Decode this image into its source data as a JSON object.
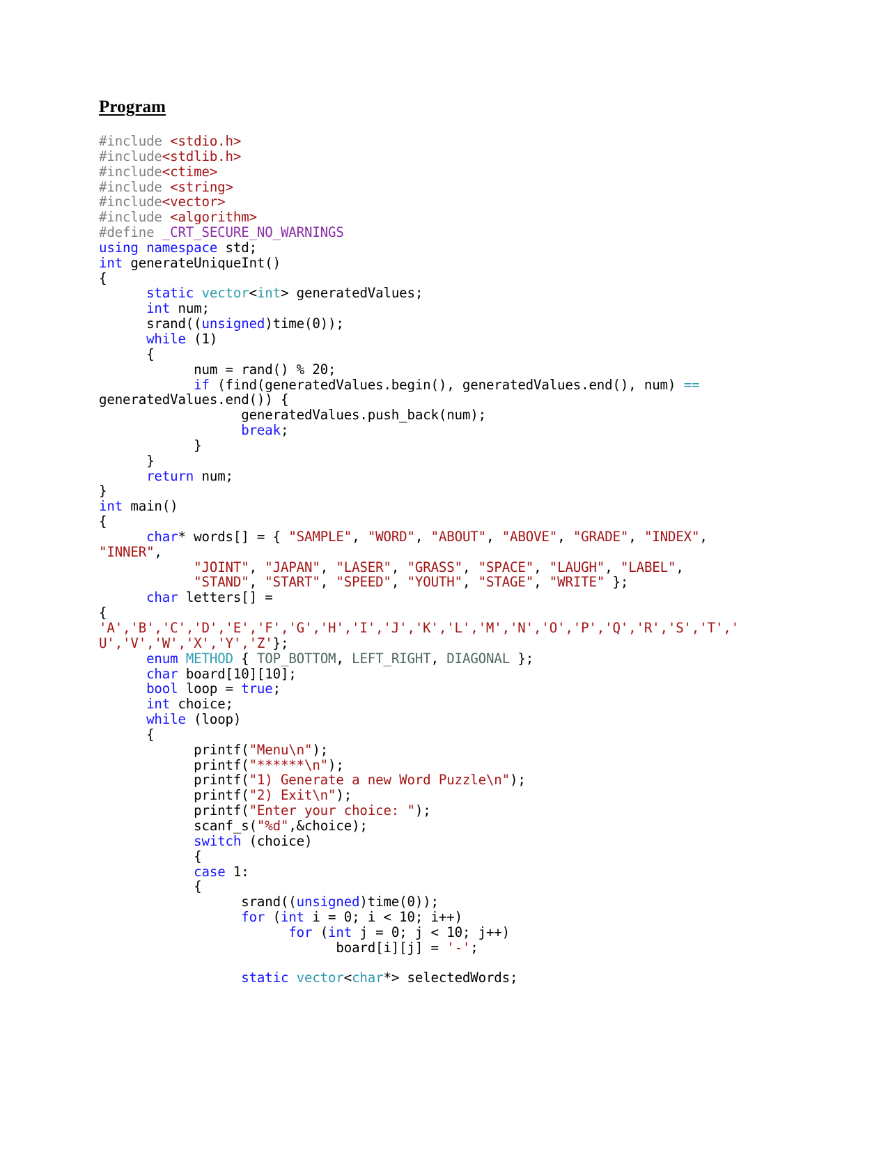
{
  "document": {
    "heading": "Program",
    "language": "cpp"
  },
  "code": {
    "lines": [
      [
        {
          "t": "#include ",
          "c": "pre"
        },
        {
          "t": "<stdio.h>",
          "c": "hdr"
        }
      ],
      [
        {
          "t": "#include",
          "c": "pre"
        },
        {
          "t": "<stdlib.h>",
          "c": "hdr"
        }
      ],
      [
        {
          "t": "#include",
          "c": "pre"
        },
        {
          "t": "<ctime>",
          "c": "hdr"
        }
      ],
      [
        {
          "t": "#include ",
          "c": "pre"
        },
        {
          "t": "<string>",
          "c": "hdr"
        }
      ],
      [
        {
          "t": "#include",
          "c": "pre"
        },
        {
          "t": "<vector>",
          "c": "hdr"
        }
      ],
      [
        {
          "t": "#include ",
          "c": "pre"
        },
        {
          "t": "<algorithm>",
          "c": "hdr"
        }
      ],
      [
        {
          "t": "#define ",
          "c": "pre"
        },
        {
          "t": "_CRT_SECURE_NO_WARNINGS",
          "c": "macro"
        }
      ],
      [
        {
          "t": "using namespace ",
          "c": "kw"
        },
        {
          "t": "std;",
          "c": "plain"
        }
      ],
      [
        {
          "t": "int",
          "c": "kw"
        },
        {
          "t": " generateUniqueInt()",
          "c": "plain"
        }
      ],
      [
        {
          "t": "{",
          "c": "plain"
        }
      ],
      [
        {
          "t": "      ",
          "c": "plain"
        },
        {
          "t": "static ",
          "c": "kw"
        },
        {
          "t": "vector",
          "c": "type"
        },
        {
          "t": "<",
          "c": "plain"
        },
        {
          "t": "int",
          "c": "type"
        },
        {
          "t": "> generatedValues;",
          "c": "plain"
        }
      ],
      [
        {
          "t": "      ",
          "c": "plain"
        },
        {
          "t": "int",
          "c": "kw"
        },
        {
          "t": " num;",
          "c": "plain"
        }
      ],
      [
        {
          "t": "      srand((",
          "c": "plain"
        },
        {
          "t": "unsigned",
          "c": "kw"
        },
        {
          "t": ")time(0));",
          "c": "plain"
        }
      ],
      [
        {
          "t": "      ",
          "c": "plain"
        },
        {
          "t": "while",
          "c": "kw"
        },
        {
          "t": " (1)",
          "c": "plain"
        }
      ],
      [
        {
          "t": "      {",
          "c": "plain"
        }
      ],
      [
        {
          "t": "            num = rand() % 20;",
          "c": "plain"
        }
      ],
      [
        {
          "t": "            ",
          "c": "plain"
        },
        {
          "t": "if",
          "c": "kw"
        },
        {
          "t": " (find(generatedValues.begin(), generatedValues.end(), num) ",
          "c": "plain"
        },
        {
          "t": "==",
          "c": "op"
        },
        {
          "t": "\ngeneratedValues.end()) {",
          "c": "plain"
        }
      ],
      [
        {
          "t": "                  generatedValues.push_back(num);",
          "c": "plain"
        }
      ],
      [
        {
          "t": "                  ",
          "c": "plain"
        },
        {
          "t": "break",
          "c": "kw"
        },
        {
          "t": ";",
          "c": "plain"
        }
      ],
      [
        {
          "t": "            }",
          "c": "plain"
        }
      ],
      [
        {
          "t": "      }",
          "c": "plain"
        }
      ],
      [
        {
          "t": "      ",
          "c": "plain"
        },
        {
          "t": "return",
          "c": "kw"
        },
        {
          "t": " num;",
          "c": "plain"
        }
      ],
      [
        {
          "t": "}",
          "c": "plain"
        }
      ],
      [
        {
          "t": "int",
          "c": "kw"
        },
        {
          "t": " main()",
          "c": "plain"
        }
      ],
      [
        {
          "t": "{",
          "c": "plain"
        }
      ],
      [
        {
          "t": "      ",
          "c": "plain"
        },
        {
          "t": "char",
          "c": "kw"
        },
        {
          "t": "* words[] = { ",
          "c": "plain"
        },
        {
          "t": "\"SAMPLE\"",
          "c": "str"
        },
        {
          "t": ", ",
          "c": "plain"
        },
        {
          "t": "\"WORD\"",
          "c": "str"
        },
        {
          "t": ", ",
          "c": "plain"
        },
        {
          "t": "\"ABOUT\"",
          "c": "str"
        },
        {
          "t": ", ",
          "c": "plain"
        },
        {
          "t": "\"ABOVE\"",
          "c": "str"
        },
        {
          "t": ", ",
          "c": "plain"
        },
        {
          "t": "\"GRADE\"",
          "c": "str"
        },
        {
          "t": ", ",
          "c": "plain"
        },
        {
          "t": "\"INDEX\"",
          "c": "str"
        },
        {
          "t": ",\n",
          "c": "plain"
        },
        {
          "t": "\"INNER\"",
          "c": "str"
        },
        {
          "t": ",",
          "c": "plain"
        }
      ],
      [
        {
          "t": "            ",
          "c": "plain"
        },
        {
          "t": "\"JOINT\"",
          "c": "str"
        },
        {
          "t": ", ",
          "c": "plain"
        },
        {
          "t": "\"JAPAN\"",
          "c": "str"
        },
        {
          "t": ", ",
          "c": "plain"
        },
        {
          "t": "\"LASER\"",
          "c": "str"
        },
        {
          "t": ", ",
          "c": "plain"
        },
        {
          "t": "\"GRASS\"",
          "c": "str"
        },
        {
          "t": ", ",
          "c": "plain"
        },
        {
          "t": "\"SPACE\"",
          "c": "str"
        },
        {
          "t": ", ",
          "c": "plain"
        },
        {
          "t": "\"LAUGH\"",
          "c": "str"
        },
        {
          "t": ", ",
          "c": "plain"
        },
        {
          "t": "\"LABEL\"",
          "c": "str"
        },
        {
          "t": ",",
          "c": "plain"
        }
      ],
      [
        {
          "t": "            ",
          "c": "plain"
        },
        {
          "t": "\"STAND\"",
          "c": "str"
        },
        {
          "t": ", ",
          "c": "plain"
        },
        {
          "t": "\"START\"",
          "c": "str"
        },
        {
          "t": ", ",
          "c": "plain"
        },
        {
          "t": "\"SPEED\"",
          "c": "str"
        },
        {
          "t": ", ",
          "c": "plain"
        },
        {
          "t": "\"YOUTH\"",
          "c": "str"
        },
        {
          "t": ", ",
          "c": "plain"
        },
        {
          "t": "\"STAGE\"",
          "c": "str"
        },
        {
          "t": ", ",
          "c": "plain"
        },
        {
          "t": "\"WRITE\"",
          "c": "str"
        },
        {
          "t": " };",
          "c": "plain"
        }
      ],
      [
        {
          "t": "      ",
          "c": "plain"
        },
        {
          "t": "char",
          "c": "kw"
        },
        {
          "t": " letters[] =",
          "c": "plain"
        }
      ],
      [
        {
          "t": "{",
          "c": "plain"
        }
      ],
      [
        {
          "t": "'A','B','C','D','E','F','G','H','I','J','K','L','M','N','O','P','Q','R','S','T','\nU','V','W','X','Y','Z'",
          "c": "str"
        },
        {
          "t": "};",
          "c": "plain"
        }
      ],
      [
        {
          "t": "      ",
          "c": "plain"
        },
        {
          "t": "enum ",
          "c": "kw"
        },
        {
          "t": "METHOD",
          "c": "type"
        },
        {
          "t": " { ",
          "c": "plain"
        },
        {
          "t": "TOP_BOTTOM",
          "c": "enum"
        },
        {
          "t": ", ",
          "c": "plain"
        },
        {
          "t": "LEFT_RIGHT",
          "c": "enum"
        },
        {
          "t": ", ",
          "c": "plain"
        },
        {
          "t": "DIAGONAL",
          "c": "enum"
        },
        {
          "t": " };",
          "c": "plain"
        }
      ],
      [
        {
          "t": "      ",
          "c": "plain"
        },
        {
          "t": "char",
          "c": "kw"
        },
        {
          "t": " board[10][10];",
          "c": "plain"
        }
      ],
      [
        {
          "t": "      ",
          "c": "plain"
        },
        {
          "t": "bool",
          "c": "kw"
        },
        {
          "t": " loop = ",
          "c": "plain"
        },
        {
          "t": "true",
          "c": "kw"
        },
        {
          "t": ";",
          "c": "plain"
        }
      ],
      [
        {
          "t": "      ",
          "c": "plain"
        },
        {
          "t": "int",
          "c": "kw"
        },
        {
          "t": " choice;",
          "c": "plain"
        }
      ],
      [
        {
          "t": "      ",
          "c": "plain"
        },
        {
          "t": "while",
          "c": "kw"
        },
        {
          "t": " (loop)",
          "c": "plain"
        }
      ],
      [
        {
          "t": "      {",
          "c": "plain"
        }
      ],
      [
        {
          "t": "            printf(",
          "c": "plain"
        },
        {
          "t": "\"Menu\\n\"",
          "c": "str"
        },
        {
          "t": ");",
          "c": "plain"
        }
      ],
      [
        {
          "t": "            printf(",
          "c": "plain"
        },
        {
          "t": "\"******\\n\"",
          "c": "str"
        },
        {
          "t": ");",
          "c": "plain"
        }
      ],
      [
        {
          "t": "            printf(",
          "c": "plain"
        },
        {
          "t": "\"1) Generate a new Word Puzzle\\n\"",
          "c": "str"
        },
        {
          "t": ");",
          "c": "plain"
        }
      ],
      [
        {
          "t": "            printf(",
          "c": "plain"
        },
        {
          "t": "\"2) Exit\\n\"",
          "c": "str"
        },
        {
          "t": ");",
          "c": "plain"
        }
      ],
      [
        {
          "t": "            printf(",
          "c": "plain"
        },
        {
          "t": "\"Enter your choice: \"",
          "c": "str"
        },
        {
          "t": ");",
          "c": "plain"
        }
      ],
      [
        {
          "t": "            scanf_s(",
          "c": "plain"
        },
        {
          "t": "\"%d\"",
          "c": "str"
        },
        {
          "t": ",&choice);",
          "c": "plain"
        }
      ],
      [
        {
          "t": "            ",
          "c": "plain"
        },
        {
          "t": "switch",
          "c": "kw"
        },
        {
          "t": " (choice)",
          "c": "plain"
        }
      ],
      [
        {
          "t": "            {",
          "c": "plain"
        }
      ],
      [
        {
          "t": "            ",
          "c": "plain"
        },
        {
          "t": "case",
          "c": "kw"
        },
        {
          "t": " 1:",
          "c": "plain"
        }
      ],
      [
        {
          "t": "            {",
          "c": "plain"
        }
      ],
      [
        {
          "t": "                  srand((",
          "c": "plain"
        },
        {
          "t": "unsigned",
          "c": "kw"
        },
        {
          "t": ")time(0));",
          "c": "plain"
        }
      ],
      [
        {
          "t": "                  ",
          "c": "plain"
        },
        {
          "t": "for",
          "c": "kw"
        },
        {
          "t": " (",
          "c": "plain"
        },
        {
          "t": "int",
          "c": "kw"
        },
        {
          "t": " i = 0; i < 10; i++)",
          "c": "plain"
        }
      ],
      [
        {
          "t": "                        ",
          "c": "plain"
        },
        {
          "t": "for",
          "c": "kw"
        },
        {
          "t": " (",
          "c": "plain"
        },
        {
          "t": "int",
          "c": "kw"
        },
        {
          "t": " j = 0; j < 10; j++)",
          "c": "plain"
        }
      ],
      [
        {
          "t": "                              board[i][j] = ",
          "c": "plain"
        },
        {
          "t": "'-'",
          "c": "str"
        },
        {
          "t": ";",
          "c": "plain"
        }
      ],
      [
        {
          "t": "",
          "c": "plain"
        }
      ],
      [
        {
          "t": "                  ",
          "c": "plain"
        },
        {
          "t": "static ",
          "c": "kw"
        },
        {
          "t": "vector",
          "c": "type"
        },
        {
          "t": "<",
          "c": "plain"
        },
        {
          "t": "char",
          "c": "type"
        },
        {
          "t": "*> selectedWords;",
          "c": "plain"
        }
      ]
    ]
  },
  "colors": {
    "preprocessor": "#808080",
    "header": "#a31515",
    "macro": "#8b2fa8",
    "keyword": "#1414ff",
    "type": "#2e9ab0",
    "string": "#a31515",
    "enum_constant": "#4d665c",
    "operator": "#2e9ab0",
    "plain": "#000000",
    "page_background": "#ffffff"
  }
}
